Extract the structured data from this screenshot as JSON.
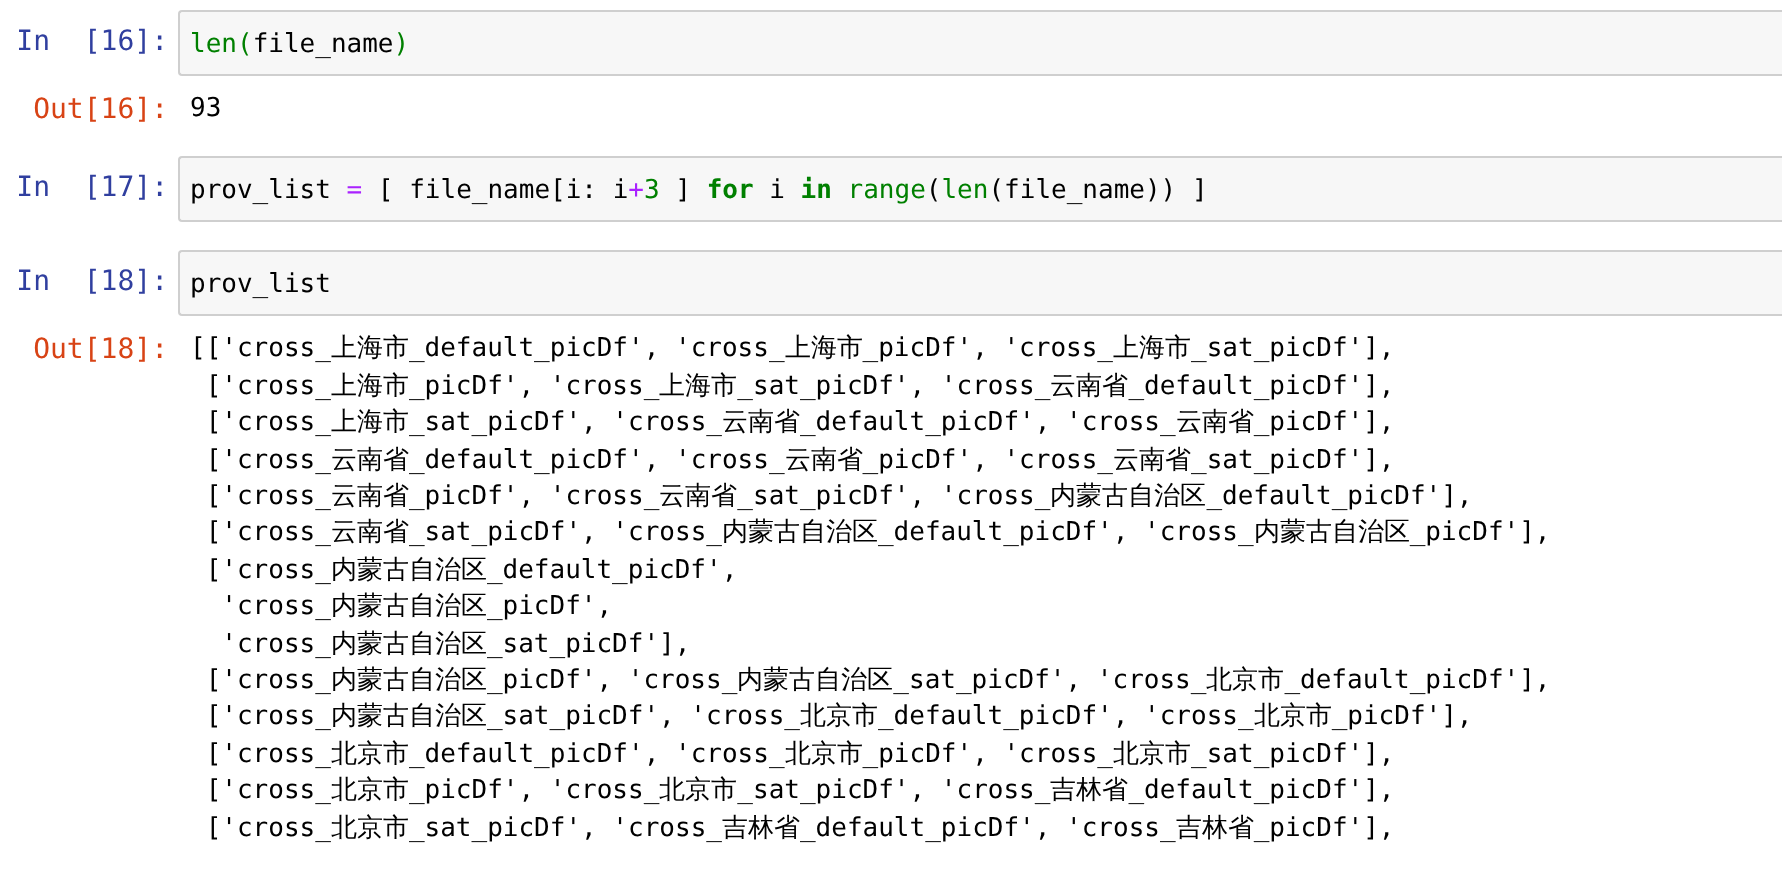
{
  "cells": [
    {
      "in_prompt": "In  [16]:",
      "code": [
        {
          "text": "len",
          "kind": "builtin"
        },
        {
          "text": "(",
          "kind": "bracket"
        },
        {
          "text": "file_name",
          "kind": "plain"
        },
        {
          "text": ")",
          "kind": "bracket"
        }
      ],
      "out_prompt": "Out[16]:",
      "output": [
        "93"
      ]
    },
    {
      "in_prompt": "In  [17]:",
      "code": [
        {
          "text": "prov_list ",
          "kind": "plain"
        },
        {
          "text": "=",
          "kind": "operator"
        },
        {
          "text": " [ file_name[i: i",
          "kind": "plain"
        },
        {
          "text": "+",
          "kind": "operator"
        },
        {
          "text": "3",
          "kind": "number"
        },
        {
          "text": " ] ",
          "kind": "plain"
        },
        {
          "text": "for",
          "kind": "keyword"
        },
        {
          "text": " i ",
          "kind": "plain"
        },
        {
          "text": "in",
          "kind": "keyword"
        },
        {
          "text": " range",
          "kind": "builtin"
        },
        {
          "text": "(",
          "kind": "plain"
        },
        {
          "text": "len",
          "kind": "builtin"
        },
        {
          "text": "(file_name)) ]",
          "kind": "plain"
        }
      ]
    },
    {
      "in_prompt": "In  [18]:",
      "code": [
        {
          "text": "prov_list",
          "kind": "plain"
        }
      ],
      "out_prompt": "Out[18]:",
      "output": [
        "[['cross_上海市_default_picDf', 'cross_上海市_picDf', 'cross_上海市_sat_picDf'],",
        " ['cross_上海市_picDf', 'cross_上海市_sat_picDf', 'cross_云南省_default_picDf'],",
        " ['cross_上海市_sat_picDf', 'cross_云南省_default_picDf', 'cross_云南省_picDf'],",
        " ['cross_云南省_default_picDf', 'cross_云南省_picDf', 'cross_云南省_sat_picDf'],",
        " ['cross_云南省_picDf', 'cross_云南省_sat_picDf', 'cross_内蒙古自治区_default_picDf'],",
        " ['cross_云南省_sat_picDf', 'cross_内蒙古自治区_default_picDf', 'cross_内蒙古自治区_picDf'],",
        " ['cross_内蒙古自治区_default_picDf',",
        "  'cross_内蒙古自治区_picDf',",
        "  'cross_内蒙古自治区_sat_picDf'],",
        " ['cross_内蒙古自治区_picDf', 'cross_内蒙古自治区_sat_picDf', 'cross_北京市_default_picDf'],",
        " ['cross_内蒙古自治区_sat_picDf', 'cross_北京市_default_picDf', 'cross_北京市_picDf'],",
        " ['cross_北京市_default_picDf', 'cross_北京市_picDf', 'cross_北京市_sat_picDf'],",
        " ['cross_北京市_picDf', 'cross_北京市_sat_picDf', 'cross_吉林省_default_picDf'],",
        " ['cross_北京市_sat_picDf', 'cross_吉林省_default_picDf', 'cross_吉林省_picDf'],"
      ]
    }
  ]
}
